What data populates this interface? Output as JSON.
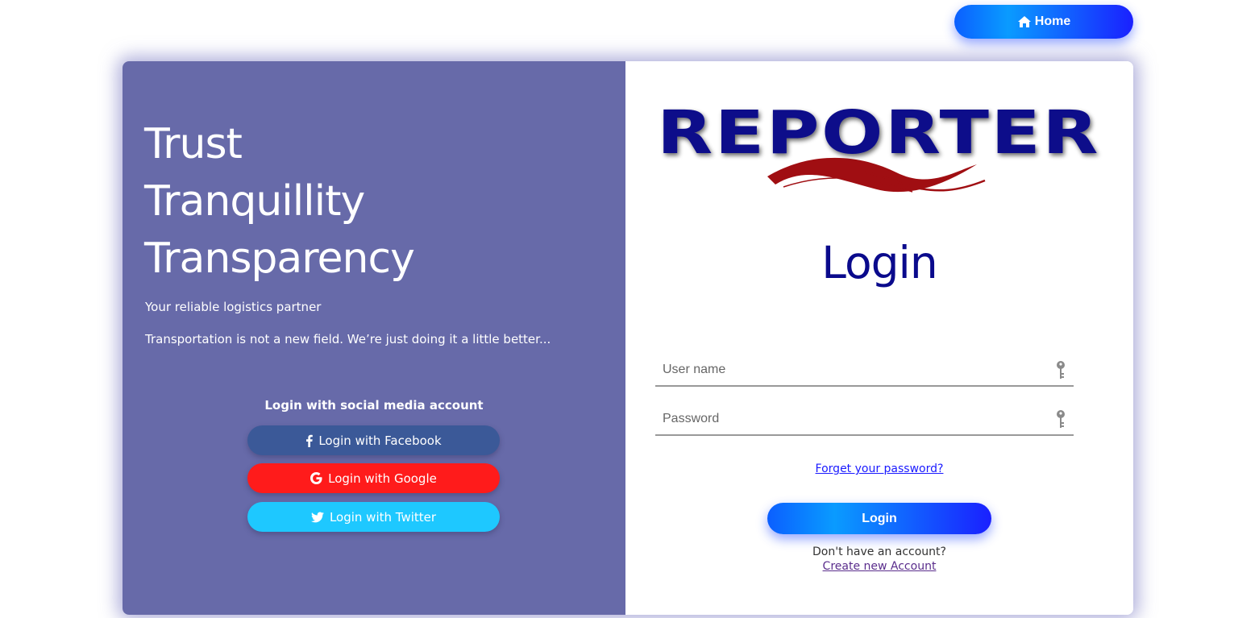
{
  "header": {
    "home_label": "Home",
    "home_icon": "home-icon"
  },
  "left": {
    "tagline": [
      "Trust",
      "Tranquillity",
      "Transparency"
    ],
    "subtitle": "Your reliable logistics partner",
    "description": "Transportation is not a new field. We’re just doing it a little better...",
    "social_title": "Login with social media account",
    "social": {
      "facebook": "Login with Facebook",
      "google": "Login with Google",
      "twitter": "Login with Twitter"
    },
    "colors": {
      "panel": "#676aa9",
      "facebook": "#3b5998",
      "google": "#ff1b1b",
      "twitter": "#1ec8ff"
    }
  },
  "right": {
    "logo_text": "REPORTER",
    "title": "Login",
    "username_placeholder": "User name",
    "password_placeholder": "Password",
    "forgot": "Forget your password?",
    "login_label": "Login",
    "no_account": "Don't have an account?",
    "create": "Create new Account",
    "colors": {
      "title": "#0a0a8c",
      "logo_blue": "#0b0b8a",
      "logo_red": "#b01010"
    }
  }
}
